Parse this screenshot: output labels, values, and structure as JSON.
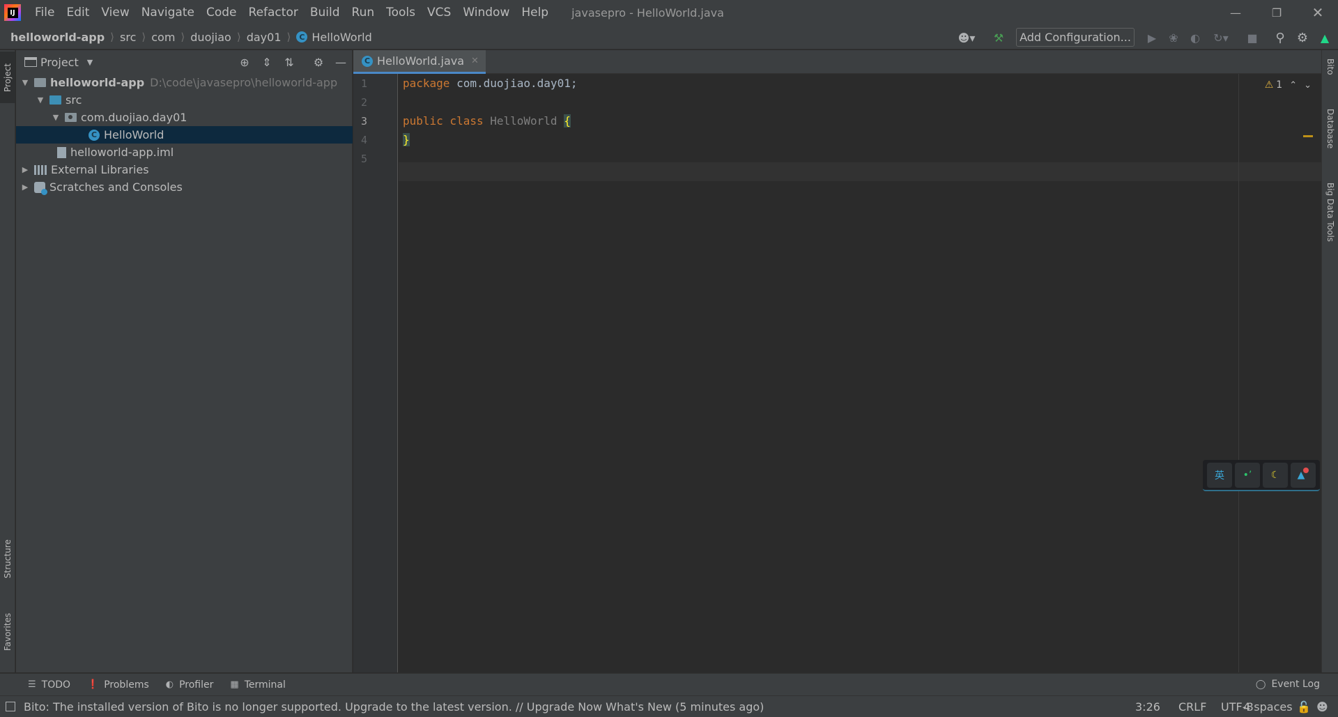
{
  "window": {
    "title": "javasepro - HelloWorld.java",
    "logo_text": "IJ",
    "menu": [
      "File",
      "Edit",
      "View",
      "Navigate",
      "Code",
      "Refactor",
      "Build",
      "Run",
      "Tools",
      "VCS",
      "Window",
      "Help"
    ]
  },
  "breadcrumb": [
    "helloworld-app",
    "src",
    "com",
    "duojiao",
    "day01",
    "HelloWorld"
  ],
  "toolbar": {
    "run_config_label": "Add Configuration..."
  },
  "left_stripe": {
    "project": "Project",
    "structure": "Structure",
    "favorites": "Favorites"
  },
  "right_stripe": {
    "bito": "Bito",
    "database": "Database",
    "big_data_tools": "Big Data Tools"
  },
  "project_panel": {
    "title": "Project",
    "tree": [
      {
        "label": "helloworld-app",
        "hint": "D:\\code\\javasepro\\helloworld-app",
        "depth": 0,
        "icon": "module-folder-icon",
        "expanded": true
      },
      {
        "label": "src",
        "depth": 1,
        "icon": "source-folder-icon",
        "expanded": true
      },
      {
        "label": "com.duojiao.day01",
        "depth": 2,
        "icon": "package-icon",
        "expanded": true
      },
      {
        "label": "HelloWorld",
        "depth": 3,
        "icon": "java-class-icon",
        "selected": true
      },
      {
        "label": "helloworld-app.iml",
        "depth": 2,
        "icon": "iml-file-icon"
      },
      {
        "label": "External Libraries",
        "depth": 0,
        "icon": "library-icon",
        "expanded": false
      },
      {
        "label": "Scratches and Consoles",
        "depth": 0,
        "icon": "scratch-icon",
        "expanded": false
      }
    ]
  },
  "editor": {
    "tab": "HelloWorld.java",
    "line_numbers": [
      "1",
      "2",
      "3",
      "4",
      "5"
    ],
    "current_line": "3",
    "code": {
      "line1_kw": "package",
      "line1_rest": " com.duojiao.day01;",
      "line3_kw": "public class",
      "line3_cls": " HelloWorld",
      "line3_brace": "{",
      "line4_brace": "}"
    },
    "warnings_count": "1"
  },
  "bottom_tools": [
    "TODO",
    "Problems",
    "Profiler",
    "Terminal"
  ],
  "event_log": "Event Log",
  "status": {
    "message": "Bito: The installed version of Bito is no longer supported. Upgrade to the latest version. // Upgrade Now   What's New (5 minutes ago)",
    "position": "3:26",
    "line_sep": "CRLF",
    "encoding": "UTF-8",
    "indent": "4 spaces"
  },
  "colors": {
    "accent": "#4a88c7",
    "keyword": "#cc7832",
    "selection": "#0d293e",
    "brace_highlight": "#ffef28"
  }
}
